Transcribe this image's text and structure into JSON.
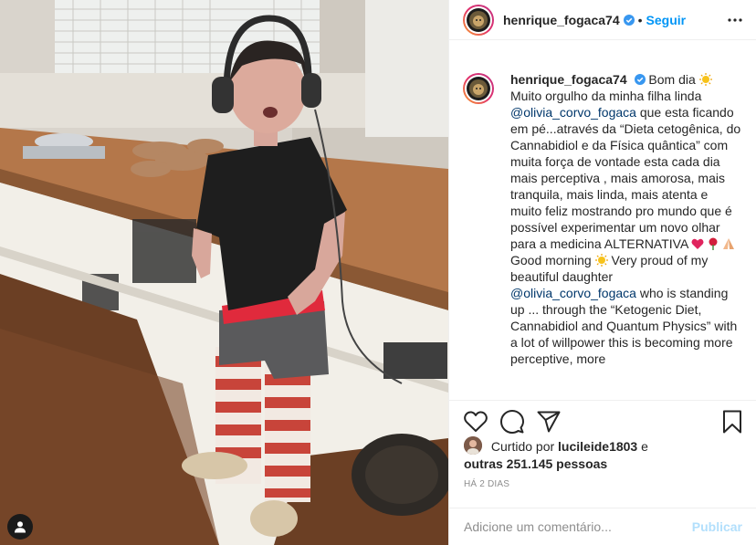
{
  "post": {
    "username": "henrique_fogaca74",
    "follow_label": "Seguir",
    "separator": "•",
    "caption": {
      "p1": "Bom dia",
      "p2": "Muito orgulho da minha filha linda",
      "mention1": "@olivia_corvo_fogaca",
      "p3": "que esta ficando em pé...através da “Dieta cetogênica, do Cannabidiol e da Física quântica” com muita força de vontade esta cada dia mais perceptiva , mais amorosa, mais tranquila, mais linda, mais atenta e muito feliz mostrando pro mundo que é possível experimentar um novo olhar para a medicina ALTERNATIVA",
      "p4": "Good morning",
      "p5": "Very proud of my beautiful daughter",
      "mention2": "@olivia_corvo_fogaca",
      "p6": "who is standing up ... through the “Ketogenic Diet, Cannabidiol and Quantum Physics” with a lot of willpower this is becoming more perceptive, more"
    },
    "likes": {
      "prefix": "Curtido por",
      "user": "lucileide1803",
      "conj": "e",
      "others": "outras 251.145 pessoas"
    },
    "timestamp": "HÁ 2 DIAS",
    "comment": {
      "placeholder": "Adicione um comentário...",
      "post_label": "Publicar"
    }
  },
  "icons": [
    "verified-icon",
    "more-icon",
    "heart-icon",
    "comment-icon",
    "share-icon",
    "bookmark-icon",
    "user-tag-icon",
    "sun-emoji",
    "heart-emoji",
    "rose-emoji",
    "pray-emoji"
  ],
  "colors": {
    "accent": "#0095f6",
    "mention": "#00376b",
    "muted": "#8e8e8e",
    "publish_disabled": "#b2dffc",
    "heart_emoji": "#e0245e"
  }
}
